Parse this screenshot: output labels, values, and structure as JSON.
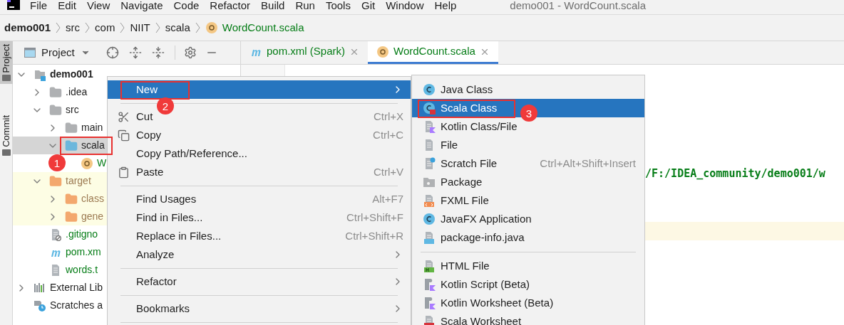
{
  "menu_bar": {
    "items": [
      "File",
      "Edit",
      "View",
      "Navigate",
      "Code",
      "Refactor",
      "Build",
      "Run",
      "Tools",
      "Git",
      "Window",
      "Help"
    ],
    "title": "demo001 - WordCount.scala"
  },
  "breadcrumb": [
    {
      "label": "demo001",
      "kind": "project"
    },
    {
      "label": "src",
      "kind": "folder"
    },
    {
      "label": "com",
      "kind": "folder"
    },
    {
      "label": "NIIT",
      "kind": "folder"
    },
    {
      "label": "scala",
      "kind": "folder"
    },
    {
      "label": "WordCount.scala",
      "kind": "file"
    }
  ],
  "side_tabs": [
    {
      "label": "Project",
      "selected": true
    },
    {
      "label": "Commit",
      "selected": false
    }
  ],
  "project_panel": {
    "title": "Project"
  },
  "editor_tabs": [
    {
      "label": "pom.xml (Spark)",
      "kind": "maven",
      "selected": false
    },
    {
      "label": "WordCount.scala",
      "kind": "scala",
      "selected": true
    }
  ],
  "tree": [
    {
      "label": "demo001",
      "kind": "module",
      "expanded": true,
      "selected": false,
      "children": [
        {
          "label": ".idea",
          "kind": "folder",
          "expanded": false,
          "selected": false
        },
        {
          "label": "src",
          "kind": "folder",
          "expanded": true,
          "selected": false,
          "children": [
            {
              "label": "main",
              "kind": "folder",
              "expanded": false,
              "selected": false
            },
            {
              "label": "scala",
              "kind": "source",
              "expanded": true,
              "selected": true,
              "callout": "1",
              "children": [
                {
                  "label": "W",
                  "kind": "scala",
                  "selected": false
                }
              ]
            }
          ]
        },
        {
          "label": "target",
          "kind": "excluded",
          "expanded": true,
          "selected": false,
          "children": [
            {
              "label": "class",
              "kind": "excluded",
              "expanded": false,
              "selected": false
            },
            {
              "label": "gene",
              "kind": "excluded",
              "expanded": false,
              "selected": false
            }
          ]
        },
        {
          "label": ".gitigno",
          "kind": "gitignore",
          "selected": false
        },
        {
          "label": "pom.xm",
          "kind": "maven",
          "selected": false
        },
        {
          "label": "words.t",
          "kind": "text",
          "selected": false
        }
      ]
    },
    {
      "label": "External Lib",
      "kind": "libraries",
      "expanded": false,
      "selected": false
    },
    {
      "label": "Scratches a",
      "kind": "scratches",
      "selected": false
    }
  ],
  "editor": {
    "lines": [
      {
        "text": "/F:/IDEA_community/demo001/w",
        "current": false
      },
      {
        "current": true
      }
    ]
  },
  "context_menu": {
    "groups": [
      [
        {
          "label": "New",
          "submenu": true,
          "selected": true,
          "callout": "2"
        }
      ],
      [
        {
          "label": "Cut",
          "kind": "scissors",
          "shortcut": "Ctrl+X",
          "selected": false
        },
        {
          "label": "Copy",
          "kind": "copy",
          "shortcut": "Ctrl+C",
          "selected": false
        },
        {
          "label": "Copy Path/Reference...",
          "selected": false
        },
        {
          "label": "Paste",
          "kind": "clipboard",
          "shortcut": "Ctrl+V",
          "selected": false
        }
      ],
      [
        {
          "label": "Find Usages",
          "shortcut": "Alt+F7",
          "selected": false
        },
        {
          "label": "Find in Files...",
          "shortcut": "Ctrl+Shift+F",
          "selected": false
        },
        {
          "label": "Replace in Files...",
          "shortcut": "Ctrl+Shift+R",
          "selected": false
        },
        {
          "label": "Analyze",
          "submenu": true,
          "selected": false
        }
      ],
      [
        {
          "label": "Refactor",
          "submenu": true,
          "selected": false
        }
      ],
      [
        {
          "label": "Bookmarks",
          "submenu": true,
          "selected": false
        }
      ]
    ]
  },
  "new_submenu": {
    "groups": [
      [
        {
          "label": "Java Class",
          "kind": "javaclass",
          "selected": false
        },
        {
          "label": "Scala Class",
          "kind": "scalaclass",
          "selected": true,
          "callout": "3"
        },
        {
          "label": "Kotlin Class/File",
          "kind": "kotlin",
          "selected": false
        },
        {
          "label": "File",
          "kind": "text",
          "selected": false
        },
        {
          "label": "Scratch File",
          "kind": "scratch",
          "shortcut": "Ctrl+Alt+Shift+Insert",
          "selected": false
        },
        {
          "label": "Package",
          "kind": "package",
          "selected": false
        },
        {
          "label": "FXML File",
          "kind": "fxml",
          "selected": false
        },
        {
          "label": "JavaFX Application",
          "kind": "javaclass",
          "selected": false
        },
        {
          "label": "package-info.java",
          "kind": "javafile",
          "selected": false
        }
      ],
      [
        {
          "label": "HTML File",
          "kind": "html",
          "selected": false
        },
        {
          "label": "Kotlin Script (Beta)",
          "kind": "kotlinscript",
          "selected": false
        },
        {
          "label": "Kotlin Worksheet (Beta)",
          "kind": "kotlinscript",
          "selected": false
        },
        {
          "label": "Scala Worksheet",
          "kind": "worksheet",
          "selected": false
        }
      ]
    ]
  }
}
